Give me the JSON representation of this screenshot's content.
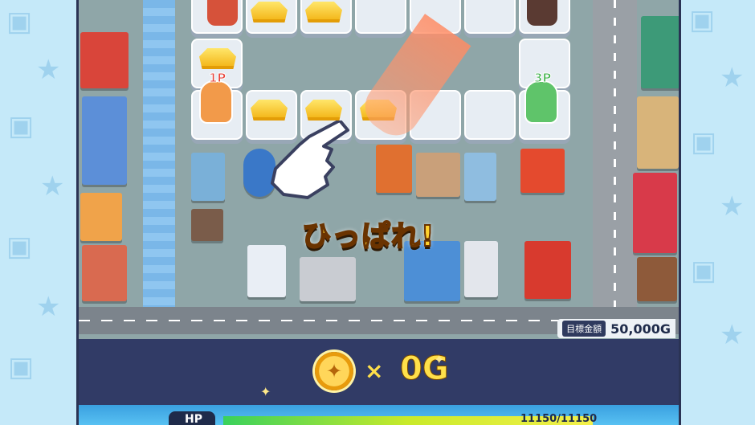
{
  "prompt": {
    "pull_text": "ひっぱれ!"
  },
  "goal": {
    "label": "目標金額",
    "value": "50,000G"
  },
  "coins": {
    "multiplier": "×",
    "count": "0G"
  },
  "players": [
    {
      "tag": "1P",
      "color": "#e8453c"
    },
    {
      "tag": "3P",
      "color": "#3fb24a"
    }
  ],
  "hp": {
    "label": "HP",
    "value": "11150/11150"
  },
  "colors": {
    "accent": "#ffd22e",
    "panel": "#242c5c",
    "hp_fill": "#39d15c"
  },
  "icons": [
    "dice-icon",
    "star-icon",
    "gold-bar-icon",
    "coin-icon",
    "pointer-hand-icon"
  ]
}
